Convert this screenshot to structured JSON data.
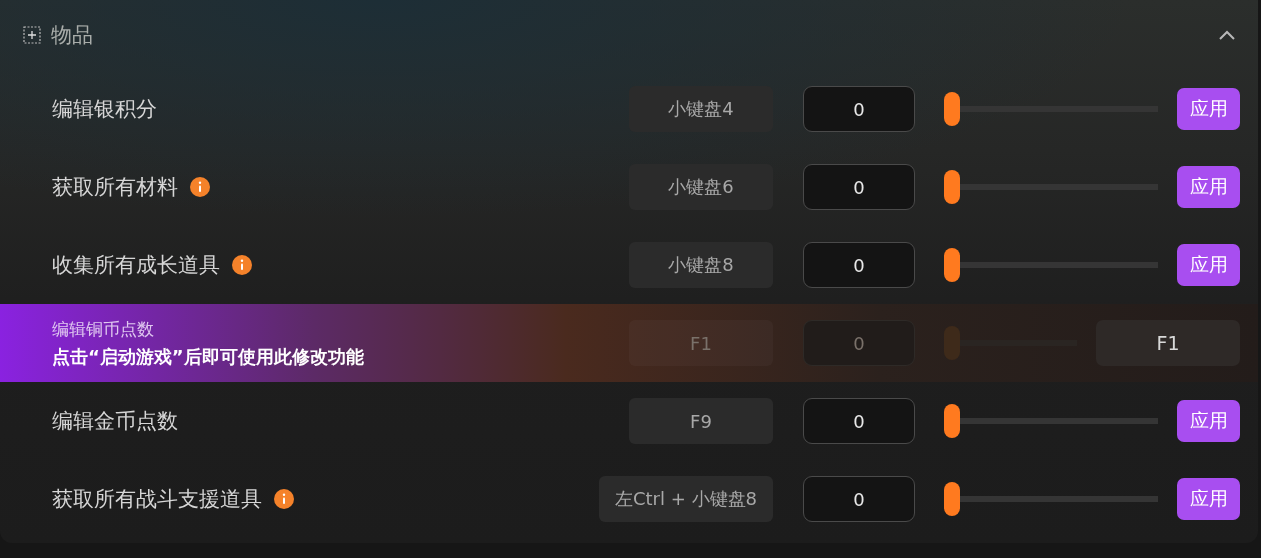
{
  "section": {
    "title": "物品",
    "expanded": true
  },
  "rows": [
    {
      "kind": "normal",
      "label": "编辑银积分",
      "info": false,
      "hotkey": "小键盘4",
      "value": "0",
      "level": 0,
      "button": "应用"
    },
    {
      "kind": "normal",
      "label": "获取所有材料",
      "info": true,
      "hotkey": "小键盘6",
      "value": "0",
      "level": 0,
      "button": "应用"
    },
    {
      "kind": "normal",
      "label": "收集所有成长道具",
      "info": true,
      "hotkey": "小键盘8",
      "value": "0",
      "level": 0,
      "button": "应用"
    },
    {
      "kind": "locked",
      "label": "编辑铜币点数",
      "message": "点击“启动游戏”后即可使用此修改功能",
      "hotkey": "F1",
      "value": "0",
      "level": 0,
      "button": "F1"
    },
    {
      "kind": "normal",
      "label": "编辑金币点数",
      "info": false,
      "hotkey": "F9",
      "value": "0",
      "level": 0,
      "button": "应用"
    },
    {
      "kind": "normal",
      "label": "获取所有战斗支援道具",
      "info": true,
      "hotkey": "左Ctrl + 小键盘8",
      "value": "0",
      "level": 0,
      "button": "应用"
    }
  ]
}
